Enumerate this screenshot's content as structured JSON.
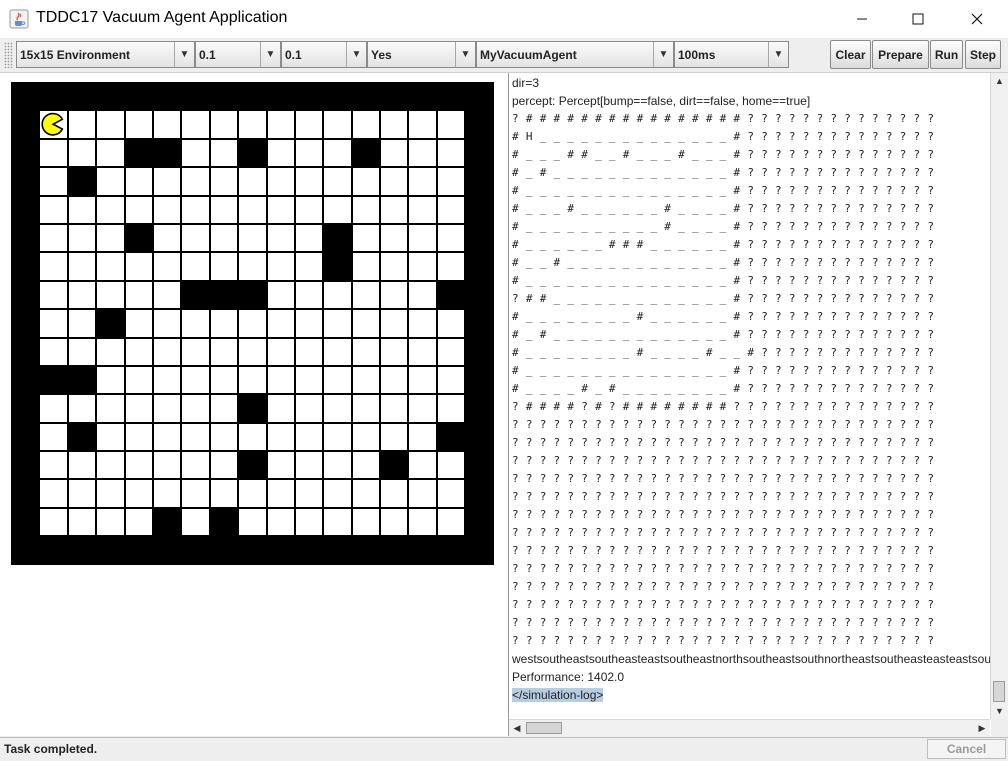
{
  "window": {
    "title": "TDDC17 Vacuum Agent Application",
    "controls": {
      "minimize": "—",
      "maximize": "☐",
      "close": "✕"
    }
  },
  "toolbar": {
    "combos": [
      {
        "name": "environment-select",
        "value": "15x15 Environment"
      },
      {
        "name": "dirt-probability-select",
        "value": "0.1"
      },
      {
        "name": "wall-probability-select",
        "value": "0.1"
      },
      {
        "name": "random-walls-select",
        "value": "Yes"
      },
      {
        "name": "agent-select",
        "value": "MyVacuumAgent"
      },
      {
        "name": "delay-select",
        "value": "100ms"
      }
    ],
    "buttons": {
      "clear": "Clear",
      "prepare": "Prepare",
      "run": "Run",
      "step": "Step"
    }
  },
  "environment": {
    "rows": 17,
    "cols": 17,
    "agent_cell": [
      1,
      1
    ],
    "agent_color": "#ffff00",
    "wall_cells": [
      [
        2,
        4
      ],
      [
        2,
        5
      ],
      [
        2,
        8
      ],
      [
        2,
        12
      ],
      [
        3,
        2
      ],
      [
        5,
        4
      ],
      [
        5,
        11
      ],
      [
        6,
        11
      ],
      [
        7,
        6
      ],
      [
        7,
        7
      ],
      [
        7,
        8
      ],
      [
        7,
        15
      ],
      [
        8,
        3
      ],
      [
        10,
        1
      ],
      [
        10,
        2
      ],
      [
        11,
        8
      ],
      [
        12,
        2
      ],
      [
        12,
        15
      ],
      [
        13,
        8
      ],
      [
        13,
        13
      ],
      [
        15,
        5
      ],
      [
        15,
        7
      ]
    ]
  },
  "log": {
    "lines": [
      "dir=3",
      "percept: Percept[bump==false, dirt==false, home==true]",
      "? # # # # # # # # # # # # # # # # ? ? ? ? ? ? ? ? ? ? ? ? ? ?",
      "# H _ _ _ _ _ _ _ _ _ _ _ _ _ _ # ? ? ? ? ? ? ? ? ? ? ? ? ? ?",
      "# _ _ _ # # _ _ # _ _ _ # _ _ _ # ? ? ? ? ? ? ? ? ? ? ? ? ? ?",
      "# _ # _ _ _ _ _ _ _ _ _ _ _ _ _ # ? ? ? ? ? ? ? ? ? ? ? ? ? ?",
      "# _ _ _ _ _ _ _ _ _ _ _ _ _ _ _ # ? ? ? ? ? ? ? ? ? ? ? ? ? ?",
      "# _ _ _ # _ _ _ _ _ _ # _ _ _ _ # ? ? ? ? ? ? ? ? ? ? ? ? ? ?",
      "# _ _ _ _ _ _ _ _ _ _ # _ _ _ _ # ? ? ? ? ? ? ? ? ? ? ? ? ? ?",
      "# _ _ _ _ _ _ # # # _ _ _ _ _ _ # ? ? ? ? ? ? ? ? ? ? ? ? ? ?",
      "# _ _ # _ _ _ _ _ _ _ _ _ _ _ _ # ? ? ? ? ? ? ? ? ? ? ? ? ? ?",
      "# _ _ _ _ _ _ _ _ _ _ _ _ _ _ _ # ? ? ? ? ? ? ? ? ? ? ? ? ? ?",
      "? # # _ _ _ _ _ _ _ _ _ _ _ _ _ # ? ? ? ? ? ? ? ? ? ? ? ? ? ?",
      "# _ _ _ _ _ _ _ _ # _ _ _ _ _ _ # ? ? ? ? ? ? ? ? ? ? ? ? ? ?",
      "# _ # _ _ _ _ _ _ _ _ _ _ _ _ _ # ? ? ? ? ? ? ? ? ? ? ? ? ? ?",
      "# _ _ _ _ _ _ _ _ # _ _ _ _ # _ _ # ? ? ? ? ? ? ? ? ? ? ? ? ?",
      "# _ _ _ _ _ _ _ _ _ _ _ _ _ _ _ # ? ? ? ? ? ? ? ? ? ? ? ? ? ?",
      "# _ _ _ _ # _ # _ _ _ _ _ _ _ _ # ? ? ? ? ? ? ? ? ? ? ? ? ? ?",
      "? # # # # ? # ? # # # # # # # # ? ? ? ? ? ? ? ? ? ? ? ? ? ? ?",
      "? ? ? ? ? ? ? ? ? ? ? ? ? ? ? ? ? ? ? ? ? ? ? ? ? ? ? ? ? ? ?",
      "? ? ? ? ? ? ? ? ? ? ? ? ? ? ? ? ? ? ? ? ? ? ? ? ? ? ? ? ? ? ?",
      "? ? ? ? ? ? ? ? ? ? ? ? ? ? ? ? ? ? ? ? ? ? ? ? ? ? ? ? ? ? ?",
      "? ? ? ? ? ? ? ? ? ? ? ? ? ? ? ? ? ? ? ? ? ? ? ? ? ? ? ? ? ? ?",
      "? ? ? ? ? ? ? ? ? ? ? ? ? ? ? ? ? ? ? ? ? ? ? ? ? ? ? ? ? ? ?",
      "? ? ? ? ? ? ? ? ? ? ? ? ? ? ? ? ? ? ? ? ? ? ? ? ? ? ? ? ? ? ?",
      "? ? ? ? ? ? ? ? ? ? ? ? ? ? ? ? ? ? ? ? ? ? ? ? ? ? ? ? ? ? ?",
      "? ? ? ? ? ? ? ? ? ? ? ? ? ? ? ? ? ? ? ? ? ? ? ? ? ? ? ? ? ? ?",
      "? ? ? ? ? ? ? ? ? ? ? ? ? ? ? ? ? ? ? ? ? ? ? ? ? ? ? ? ? ? ?",
      "? ? ? ? ? ? ? ? ? ? ? ? ? ? ? ? ? ? ? ? ? ? ? ? ? ? ? ? ? ? ?",
      "? ? ? ? ? ? ? ? ? ? ? ? ? ? ? ? ? ? ? ? ? ? ? ? ? ? ? ? ? ? ?",
      "? ? ? ? ? ? ? ? ? ? ? ? ? ? ? ? ? ? ? ? ? ? ? ? ? ? ? ? ? ? ?",
      "? ? ? ? ? ? ? ? ? ? ? ? ? ? ? ? ? ? ? ? ? ? ? ? ? ? ? ? ? ? ?",
      "westsoutheastsoutheasteastsoutheastnorthsoutheastsouthnortheastsoutheasteasteastsouth",
      "Performance: 1402.0",
      "</simulation-log>"
    ],
    "highlighted_line": 34
  },
  "status": {
    "text": "Task completed.",
    "cancel_label": "Cancel"
  },
  "colors": {
    "selection": "#b5cde3",
    "background": "#eeeeee"
  }
}
